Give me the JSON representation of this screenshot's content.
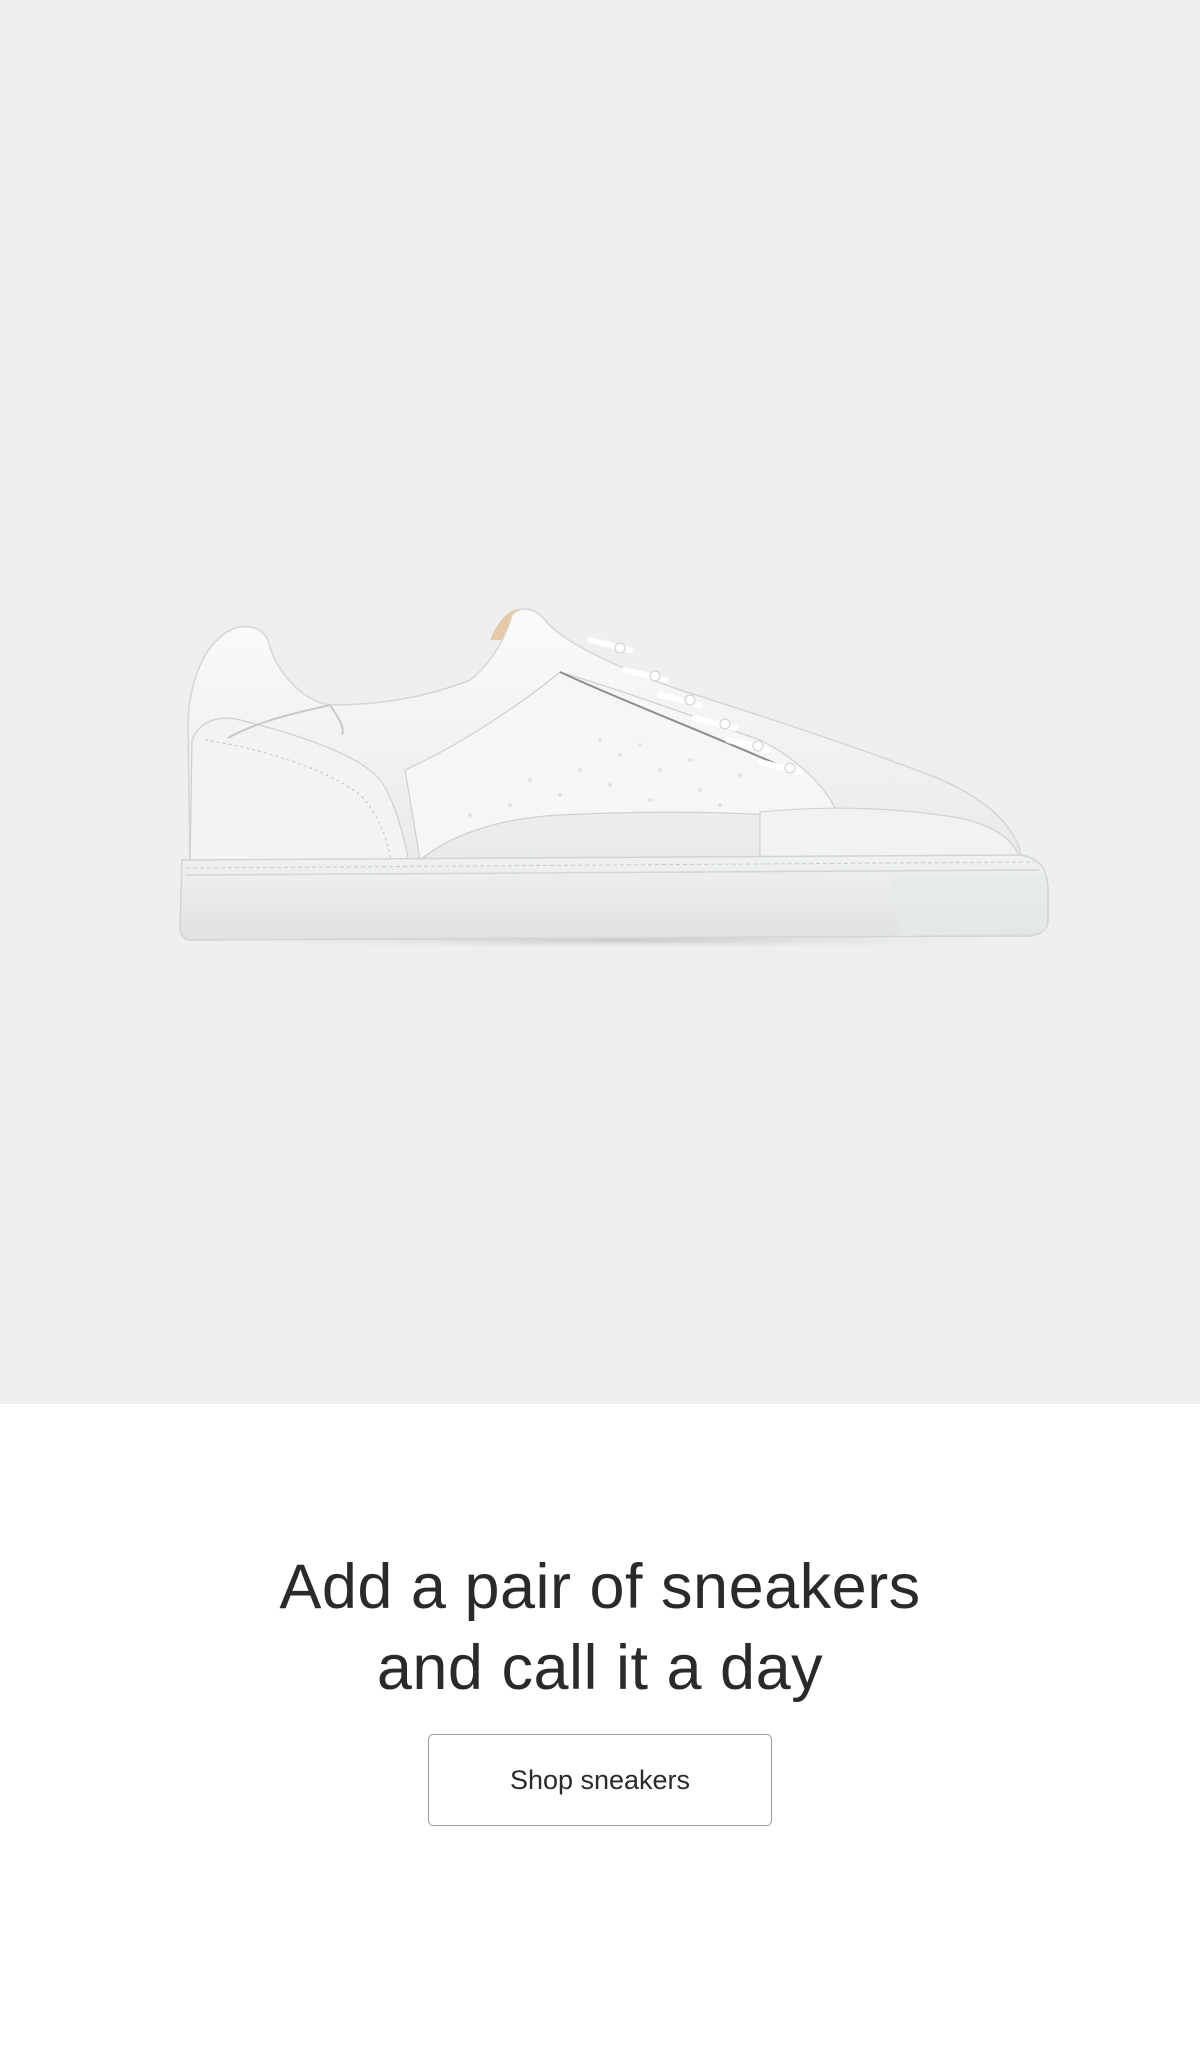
{
  "hero": {
    "image_alt": "White leather low-top sneaker, side view",
    "background_color": "#efefef"
  },
  "promo": {
    "headline_line1": "Add a pair of sneakers",
    "headline_line2": "and call it a day",
    "button_label": "Shop sneakers"
  }
}
